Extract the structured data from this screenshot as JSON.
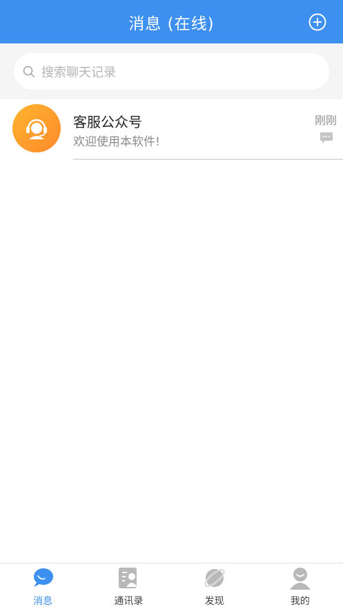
{
  "header": {
    "title": "消息 (在线)",
    "add_icon": "plus-circle-icon"
  },
  "search": {
    "placeholder": "搜索聊天记录",
    "icon": "search-icon"
  },
  "conversations": [
    {
      "name": "客服公众号",
      "preview": "欢迎使用本软件!",
      "time": "刚刚",
      "avatar_icon": "customer-service-headset-icon",
      "status_icon": "message-bubble-icon"
    }
  ],
  "tabbar": {
    "tabs": [
      {
        "label": "消息",
        "icon": "chat-bubble-icon",
        "active": true
      },
      {
        "label": "通讯录",
        "icon": "contacts-book-icon",
        "active": false
      },
      {
        "label": "发现",
        "icon": "planet-icon",
        "active": false
      },
      {
        "label": "我的",
        "icon": "user-profile-icon",
        "active": false
      }
    ]
  },
  "colors": {
    "primary": "#3d8ff0",
    "avatar_gradient_start": "#ffb42e",
    "avatar_gradient_end": "#ff8a2b",
    "inactive_icon": "#b8b8b8"
  }
}
